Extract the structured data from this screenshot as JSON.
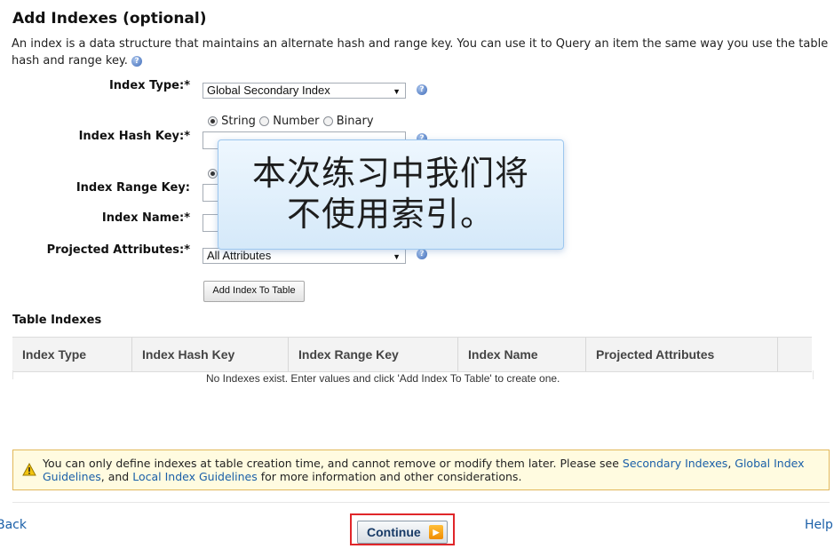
{
  "header": {
    "title": "Add Indexes (optional)",
    "intro": "An index is a data structure that maintains an alternate hash and range key. You can use it to Query an item the same way you use the table hash and range key."
  },
  "form": {
    "index_type": {
      "label": "Index Type:*",
      "value": "Global Secondary Index"
    },
    "hash_key": {
      "label": "Index Hash Key:*",
      "options": [
        "String",
        "Number",
        "Binary"
      ],
      "selected": "String",
      "value": ""
    },
    "range_key": {
      "label": "Index Range Key:",
      "value": ""
    },
    "index_name": {
      "label": "Index Name:*",
      "value": ""
    },
    "projected": {
      "label": "Projected Attributes:*",
      "value": "All Attributes"
    },
    "add_button": "Add Index To Table"
  },
  "table": {
    "title": "Table Indexes",
    "columns": [
      "Index Type",
      "Index Hash Key",
      "Index Range Key",
      "Index Name",
      "Projected Attributes"
    ],
    "empty_message": "No Indexes exist. Enter values and click 'Add Index To Table' to create one."
  },
  "warning": {
    "text_before": "You can only define indexes at table creation time, and cannot remove or modify them later. Please see ",
    "link1": "Secondary Indexes",
    "sep1": ", ",
    "link2": "Global Index Guidelines",
    "sep2": ", and ",
    "link3": "Local Index Guidelines",
    "text_after": " for more information and other considerations."
  },
  "footer": {
    "back": "Back",
    "continue": "Continue",
    "help": "Help"
  },
  "overlay": {
    "line1": "本次练习中我们将",
    "line2": "不使用索引。"
  },
  "colors": {
    "link": "#1a5fa8",
    "highlight": "#e0262a",
    "warning_bg": "#fffbe0"
  },
  "icons": [
    "help-icon",
    "warning-icon",
    "arrow-right-icon",
    "dropdown-arrow-icon"
  ]
}
